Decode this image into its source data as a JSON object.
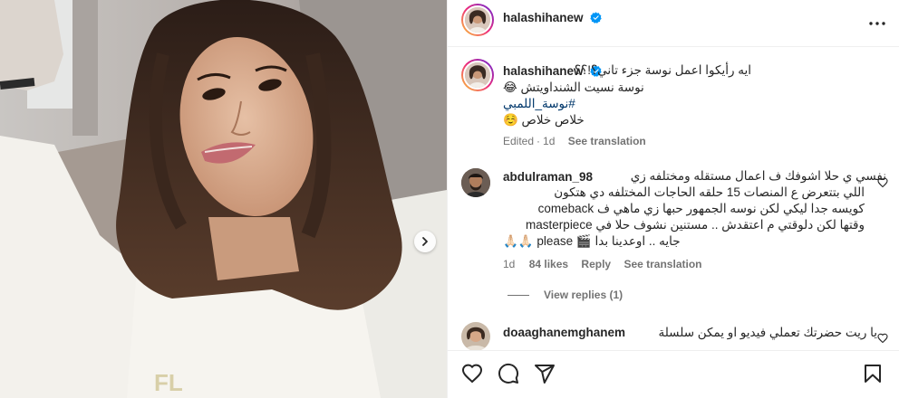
{
  "post": {
    "username": "halashihanew",
    "verified": true,
    "more_icon": "more-horizontal-icon",
    "media": {
      "carousel_next_icon": "chevron-right-icon"
    }
  },
  "caption": {
    "username": "halashihanew",
    "line1": "ايه رأيكوا اعمل نوسة جزء تاني؟!؟؟",
    "line2": "نوسة نسيت الشنداويتش 😂",
    "hashtag": "#نوسة_اللمبي",
    "line4": "خلاص خلاص ☺️",
    "edited": "Edited",
    "dot": "·",
    "time": "1d",
    "see_translation": "See translation"
  },
  "comments": [
    {
      "username": "abdulraman_98",
      "lines": [
        "نفسي ي حلا اشوفك ف اعمال مستقله ومختلفه زي",
        "اللي بتتعرض ع المنصات 15 حلقه الحاجات المختلفه دي هتكون",
        "كويسه جدا ليكي لكن نوسه الجمهور حبها زي ماهي ف comeback",
        "وقتها لكن دلوقتي م اعتقدش .. مستنين نشوف حلا في masterpiece",
        "جايه .. اوعدينا بدا 🎬 please 🙏🏻🙏🏻"
      ],
      "time": "1d",
      "likes": "84 likes",
      "reply": "Reply",
      "see_translation": "See translation",
      "view_replies": "View replies (1)"
    },
    {
      "username": "doaaghanemghanem",
      "lines": [
        "يا ريت حضرتك تعملي فيديو او يمكن سلسلة"
      ]
    }
  ],
  "actions": {
    "like_icon": "heart-icon",
    "comment_icon": "comment-icon",
    "share_icon": "share-icon",
    "save_icon": "bookmark-icon"
  },
  "colors": {
    "verified": "#0095f6",
    "text": "#262626",
    "secondary": "#737373",
    "hashtag": "#00376b",
    "divider": "#efefef"
  }
}
